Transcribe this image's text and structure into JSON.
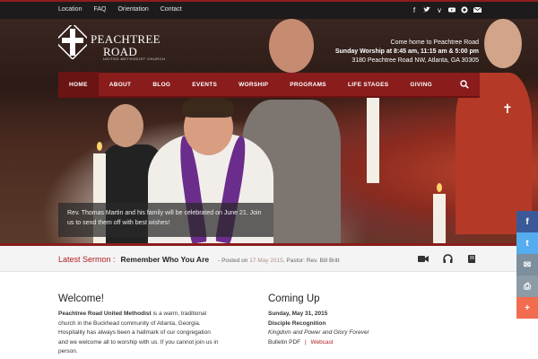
{
  "topbar": {
    "links": [
      "Location",
      "FAQ",
      "Orientation",
      "Contact"
    ],
    "social_icons": [
      "facebook-icon",
      "twitter-icon",
      "vimeo-icon",
      "youtube-icon",
      "instagram-icon",
      "email-icon"
    ]
  },
  "logo": {
    "line1": "PEACHTREE",
    "line2": "ROAD",
    "sub": "UNITED METHODIST CHURCH"
  },
  "worship": {
    "line1": "Come home to Peachtree Road",
    "line2": "Sunday Worship at 8:45 am, 11:15 am & 5:00 pm",
    "line3": "3180 Peachtree Road NW, Atlanta, GA 30305"
  },
  "nav": {
    "items": [
      "HOME",
      "ABOUT",
      "BLOG",
      "EVENTS",
      "WORSHIP",
      "PROGRAMS",
      "LIFE STAGES",
      "GIVING"
    ],
    "active": "HOME"
  },
  "hero": {
    "caption": "Rev. Thomas Martin and his family will be celebrated on June 21. Join us to send them off with best wishes!"
  },
  "sermon": {
    "label": "Latest Sermon :",
    "title": "Remember Who You Are",
    "posted_prefix": "Posted on",
    "date": "17 May 2015",
    "pastor": ", Pastor: Rev. Bill Britt",
    "icons": [
      "video-icon",
      "audio-icon",
      "book-icon"
    ]
  },
  "welcome": {
    "heading": "Welcome!",
    "strong": "Peachtree Road United Methodist",
    "body": " is a warm, traditional church in the Buckhead community of Atlanta, Georgia.  Hospitality has always been a hallmark of our congregation and we welcome all to worship with us.  If you cannot join us in person."
  },
  "coming_up": {
    "heading": "Coming Up",
    "date": "Sunday, May 31, 2015",
    "event": "Disciple Recognition",
    "description": "Kingdom and Power and Glory Forever",
    "bulletin": "Bulletin PDF",
    "separator": "|",
    "webcast": "Webcast"
  },
  "share": {
    "colors": [
      "#3b5998",
      "#55acee",
      "#7d8f9c",
      "#8c9ba6",
      "#f26c4f"
    ],
    "icons": [
      "facebook-share-icon",
      "twitter-share-icon",
      "email-share-icon",
      "print-share-icon",
      "more-share-icon"
    ],
    "glyphs": [
      "f",
      "t",
      "✉",
      "⎙",
      "+"
    ]
  },
  "colors": {
    "accent": "#8a1c1c",
    "link": "#b02020"
  }
}
